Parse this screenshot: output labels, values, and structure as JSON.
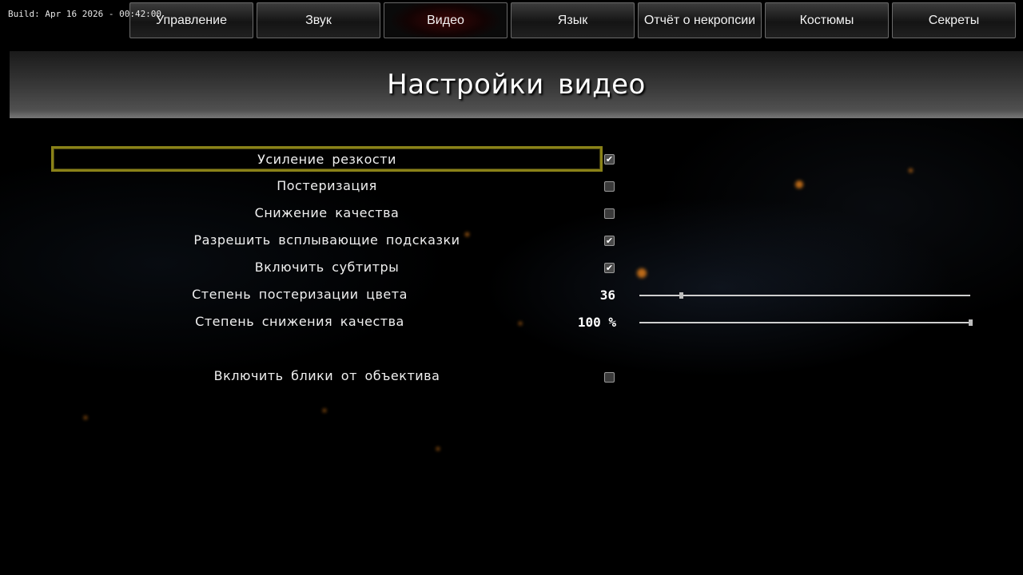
{
  "build_info": "Build: Apr 16 2026 - 00:42:00",
  "tabs": [
    {
      "label": "Управление",
      "active": false
    },
    {
      "label": "Звук",
      "active": false
    },
    {
      "label": "Видео",
      "active": true
    },
    {
      "label": "Язык",
      "active": false
    },
    {
      "label": "Отчёт о некропсии",
      "active": false
    },
    {
      "label": "Костюмы",
      "active": false
    },
    {
      "label": "Секреты",
      "active": false
    }
  ],
  "page_title": "Настройки видео",
  "options": [
    {
      "label": "Усиление резкости",
      "checked": true,
      "selected": true
    },
    {
      "label": "Постеризация",
      "checked": false
    },
    {
      "label": "Снижение качества",
      "checked": false
    },
    {
      "label": "Разрешить всплывающие подсказки",
      "checked": true
    },
    {
      "label": "Включить субтитры",
      "checked": true
    }
  ],
  "sliders": [
    {
      "label": "Степень постеризации цвета",
      "value_text": "36",
      "fraction": 0.126
    },
    {
      "label": "Степень снижения качества",
      "value_text": "100 %",
      "fraction": 1.0
    }
  ],
  "lens_flare": {
    "label": "Включить блики от объектива",
    "checked": false
  },
  "colors": {
    "accent_border": "#8a8218",
    "active_tab": "#3a0505"
  }
}
